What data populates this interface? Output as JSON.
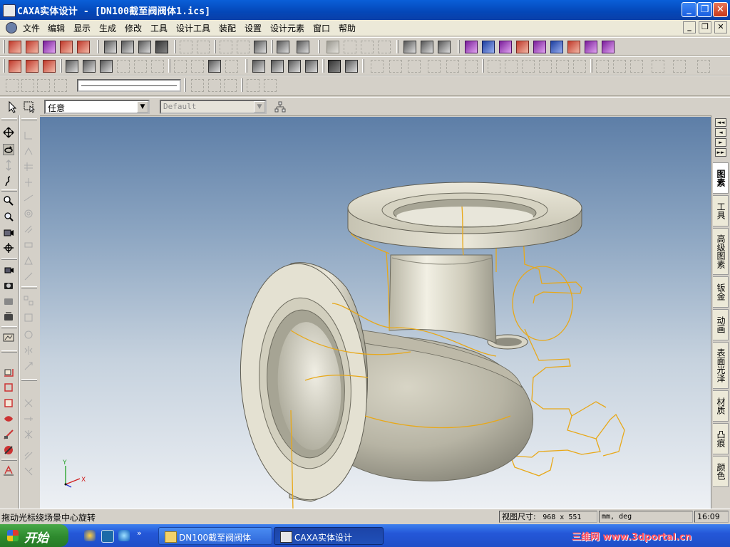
{
  "window": {
    "title": "CAXA实体设计 - [DN100截至阀阀体1.ics]",
    "controls": {
      "minimize": "_",
      "maximize": "❐",
      "close": "✕"
    }
  },
  "menubar": {
    "items": [
      "文件",
      "编辑",
      "显示",
      "生成",
      "修改",
      "工具",
      "设计工具",
      "装配",
      "设置",
      "设计元素",
      "窗口",
      "帮助"
    ],
    "mdi_controls": {
      "minimize": "_",
      "restore": "❐",
      "close": "✕"
    }
  },
  "selection": {
    "filter_value": "任意",
    "style_value": "Default"
  },
  "right_tabs": [
    "图素",
    "工具",
    "高级图素",
    "钣金",
    "动画",
    "表面光泽",
    "材质",
    "凸痕",
    "颜色"
  ],
  "right_nav": [
    "◄◄",
    "◄",
    "►",
    "►►"
  ],
  "viewport": {
    "axis_labels": {
      "y": "Y",
      "x": "X"
    },
    "colors": {
      "part": "#c9c6b6",
      "edge_highlight": "#e8a818",
      "background_top": "#5d7ea7",
      "background_bottom": "#edf0f4"
    }
  },
  "statusbar": {
    "message": "拖动光标绕场景中心旋转",
    "view_size_label": "视图尺寸:",
    "view_size_value": "968 x  551",
    "units": "mm, deg",
    "time": "16:09"
  },
  "taskbar": {
    "start_label": "开始",
    "tasks": [
      "DN100截至阀阀体",
      "CAXA实体设计"
    ],
    "watermark": "三维网 www.3dportal.cn"
  }
}
